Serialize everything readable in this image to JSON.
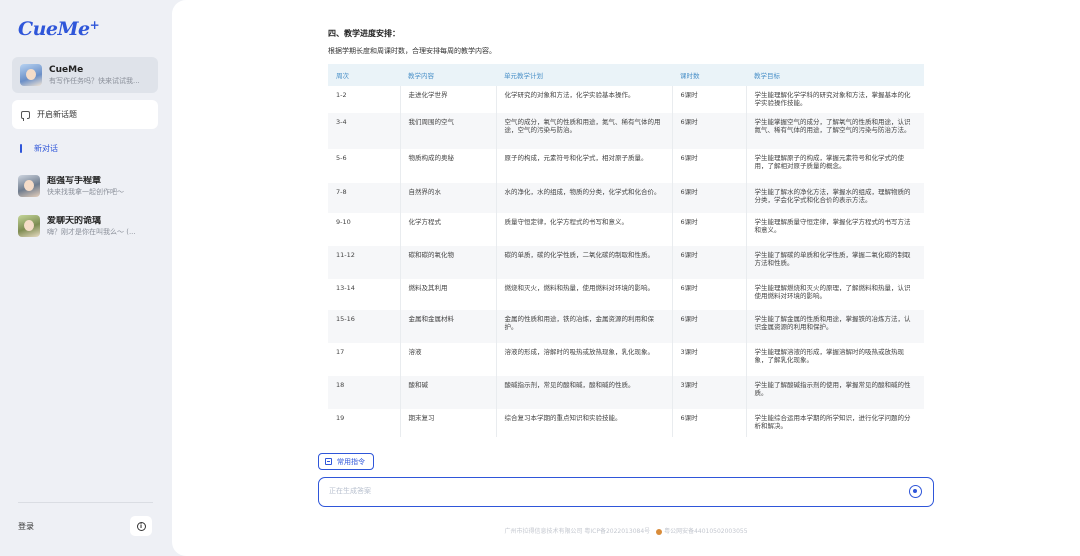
{
  "sidebar": {
    "logo": "CueMe",
    "logo_mark": "+",
    "active_chat": {
      "title": "CueMe",
      "subtitle": "有写作任务吗？快来试试我..."
    },
    "new_topic_label": "开启新话题",
    "new_dialog_label": "新对话",
    "contacts": [
      {
        "title": "超强写手程章",
        "subtitle": "快来找我拿一起创作吧～"
      },
      {
        "title": "爱聊天的诡璃",
        "subtitle": "嗨？刚才是你在叫我么～ (..."
      }
    ],
    "login_label": "登录",
    "info_icon": "ⓘ"
  },
  "document": {
    "section_title": "四、教学进度安排：",
    "intro": "根据学期长度和周课时数，合理安排每周的教学内容。",
    "table": {
      "headers": [
        "周次",
        "教学内容",
        "单元教学计划",
        "课时数",
        "教学目标"
      ],
      "rows": [
        [
          "1-2",
          "走进化学世界",
          "化学研究的对象和方法，化学实验基本操作。",
          "6课时",
          "学生能理解化学学科的研究对象和方法，掌握基本的化学实验操作技能。"
        ],
        [
          "3-4",
          "我们周围的空气",
          "空气的成分，氧气的性质和用途，氮气、稀有气体的用途，空气的污染与防治。",
          "6课时",
          "学生能掌握空气的成分，了解氧气的性质和用途，认识氮气、稀有气体的用途，了解空气的污染与防治方法。"
        ],
        [
          "5-6",
          "物质构成的奥秘",
          "原子的构成，元素符号和化学式，相对原子质量。",
          "6课时",
          "学生能理解原子的构成，掌握元素符号和化学式的使用，了解相对原子质量的概念。"
        ],
        [
          "7-8",
          "自然界的水",
          "水的净化，水的组成，物质的分类，化学式和化合价。",
          "6课时",
          "学生能了解水的净化方法，掌握水的组成，理解物质的分类，学会化学式和化合价的表示方法。"
        ],
        [
          "9-10",
          "化学方程式",
          "质量守恒定律，化学方程式的书写和意义。",
          "6课时",
          "学生能理解质量守恒定律，掌握化学方程式的书写方法和意义。"
        ],
        [
          "11-12",
          "碳和碳的氧化物",
          "碳的单质，碳的化学性质，二氧化碳的制取和性质。",
          "6课时",
          "学生能了解碳的单质和化学性质，掌握二氧化碳的制取方法和性质。"
        ],
        [
          "13-14",
          "燃料及其利用",
          "燃烧和灭火，燃料和热量，使用燃料对环境的影响。",
          "6课时",
          "学生能理解燃烧和灭火的原理，了解燃料和热量，认识使用燃料对环境的影响。"
        ],
        [
          "15-16",
          "金属和金属材料",
          "金属的性质和用途，铁的冶炼，金属资源的利用和保护。",
          "6课时",
          "学生能了解金属的性质和用途，掌握铁的冶炼方法，认识金属资源的利用和保护。"
        ],
        [
          "17",
          "溶液",
          "溶液的形成，溶解时的吸热或放热现象，乳化现象。",
          "3课时",
          "学生能理解溶液的形成，掌握溶解时的吸热或放热现象，了解乳化现象。"
        ],
        [
          "18",
          "酸和碱",
          "酸碱指示剂，常见的酸和碱，酸和碱的性质。",
          "3课时",
          "学生能了解酸碱指示剂的使用，掌握常见的酸和碱的性质。"
        ],
        [
          "19",
          "期末复习",
          "综合复习本学期的重点知识和实验技能。",
          "6课时",
          "学生能综合运用本学期的所学知识，进行化学问题的分析和解决。"
        ]
      ]
    }
  },
  "composer": {
    "commands_label": "常用指令",
    "input_placeholder": "正在生成答案"
  },
  "footer": {
    "company": "广州市拉得信息技术有限公司",
    "icp": "粤ICP备2022013084号",
    "police": "粤公网安备44010502003055"
  },
  "colors": {
    "accent": "#2f56d9",
    "table_header_bg": "#eaf3f8",
    "table_header_text": "#4a90c8",
    "sidebar_bg": "#eef0f5"
  }
}
